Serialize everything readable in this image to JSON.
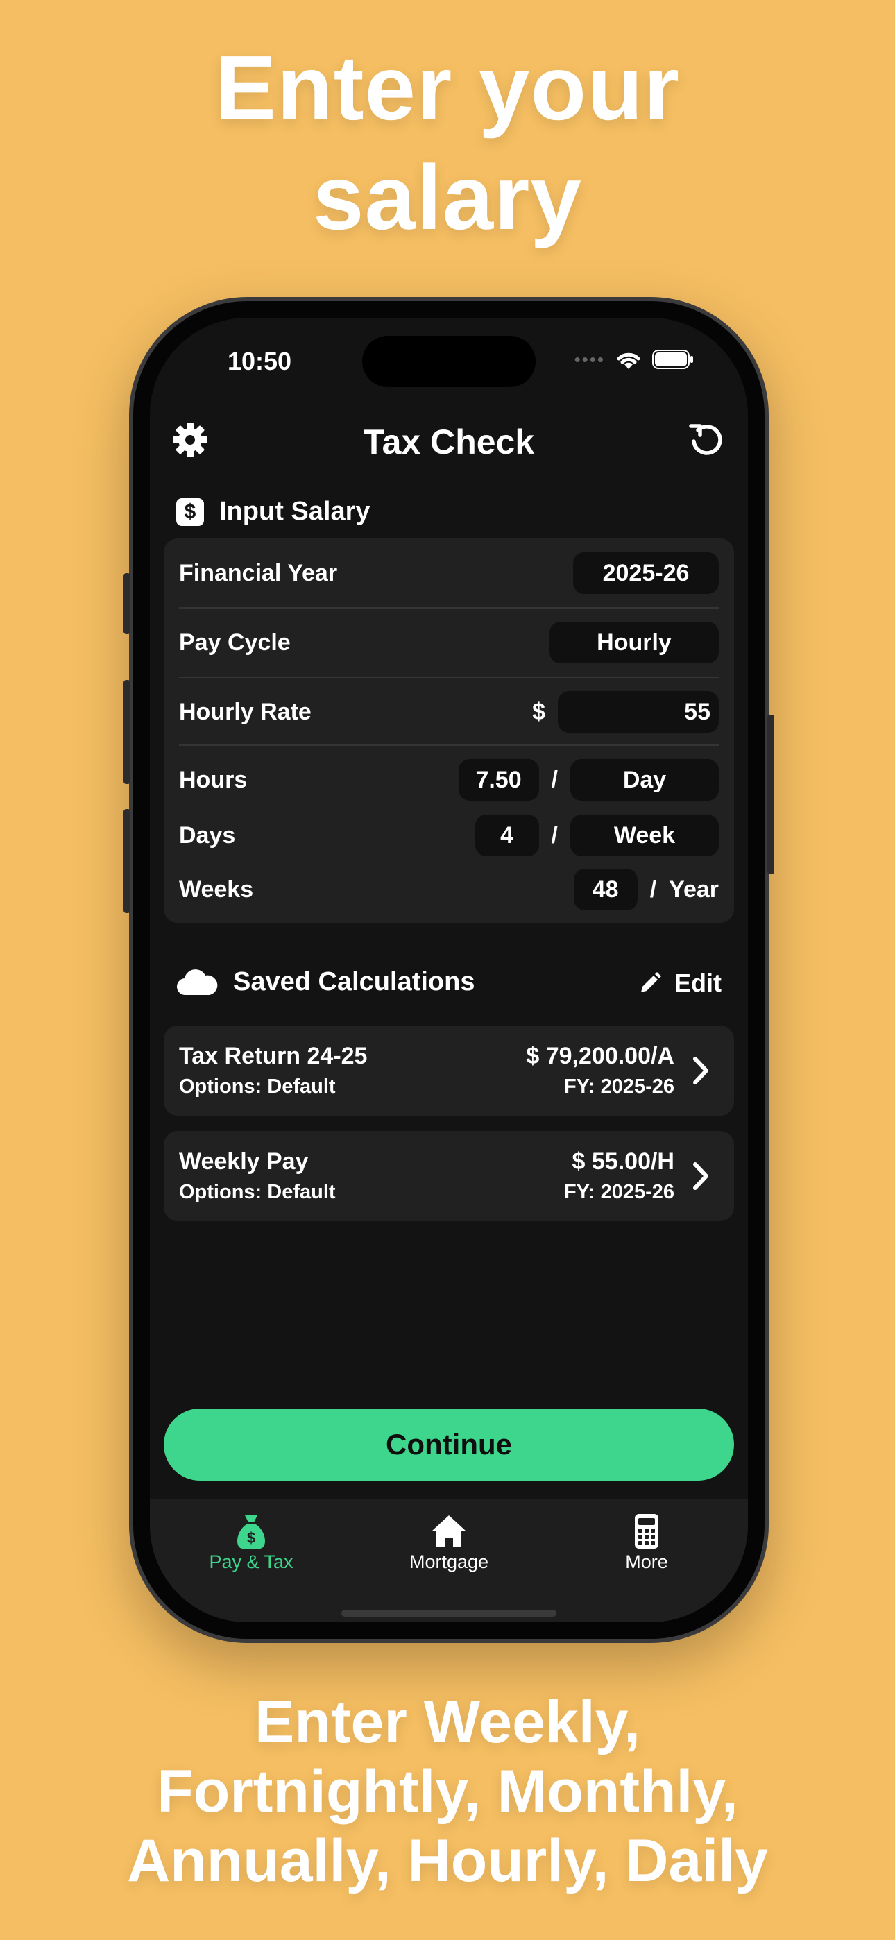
{
  "promo": {
    "headline_line1": "Enter your",
    "headline_line2": "salary",
    "footer_line1": "Enter Weekly,",
    "footer_line2": "Fortnightly, Monthly,",
    "footer_line3": "Annually, Hourly, Daily"
  },
  "status": {
    "time": "10:50",
    "signal_dots": "••••"
  },
  "nav": {
    "title": "Tax Check",
    "settings_icon": "gear-icon",
    "reset_icon": "reset-icon"
  },
  "input": {
    "section_title": "Input Salary",
    "section_icon_glyph": "$",
    "financial_year_label": "Financial Year",
    "financial_year_value": "2025-26",
    "pay_cycle_label": "Pay Cycle",
    "pay_cycle_value": "Hourly",
    "hourly_rate_label": "Hourly Rate",
    "currency_symbol": "$",
    "hourly_rate_value": "55",
    "hours_label": "Hours",
    "hours_value": "7.50",
    "hours_unit": "Day",
    "days_label": "Days",
    "days_value": "4",
    "days_unit": "Week",
    "weeks_label": "Weeks",
    "weeks_value": "48",
    "weeks_unit": "Year",
    "slash": "/"
  },
  "saved": {
    "section_title": "Saved Calculations",
    "edit_label": "Edit",
    "items": [
      {
        "title": "Tax Return 24-25",
        "options": "Options: Default",
        "amount": "$ 79,200.00/A",
        "fy": "FY: 2025-26"
      },
      {
        "title": "Weekly Pay",
        "options": "Options: Default",
        "amount": "$ 55.00/H",
        "fy": "FY: 2025-26"
      }
    ]
  },
  "continue_label": "Continue",
  "tabs": [
    {
      "label": "Pay & Tax",
      "icon": "money-bag-icon",
      "active": true
    },
    {
      "label": "Mortgage",
      "icon": "house-icon",
      "active": false
    },
    {
      "label": "More",
      "icon": "calculator-icon",
      "active": false
    }
  ],
  "colors": {
    "background": "#F5BE62",
    "accent": "#3DD68C",
    "screen": "#131313",
    "card": "#212121"
  }
}
